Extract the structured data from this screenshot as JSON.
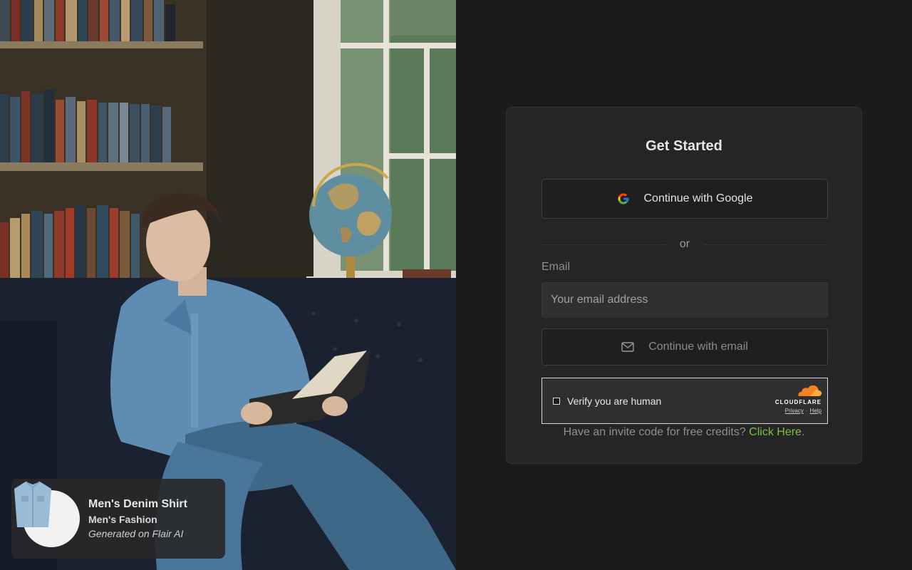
{
  "auth": {
    "title": "Get Started",
    "google_label": "Continue with Google",
    "divider_text": "or",
    "email_label": "Email",
    "email_placeholder": "Your email address",
    "email_value": "",
    "email_button_label": "Continue with email",
    "captcha": {
      "label": "Verify you are human",
      "brand": "CLOUDFLARE",
      "privacy": "Privacy",
      "separator": "·",
      "help": "Help"
    },
    "invite_text": "Have an invite code for free credits?",
    "invite_link": "Click Here",
    "invite_suffix": "."
  },
  "product": {
    "name": "Men's Denim Shirt",
    "category": "Men's Fashion",
    "generated": "Generated on Flair AI"
  },
  "colors": {
    "accent_link": "#79c23c",
    "background": "#1b1b1d",
    "card": "#252527",
    "cloudflare_orange": "#f48120"
  },
  "icons": {
    "google": "google-g-icon",
    "email": "mail-envelope-icon",
    "cloudflare": "cloudflare-cloud-icon"
  }
}
